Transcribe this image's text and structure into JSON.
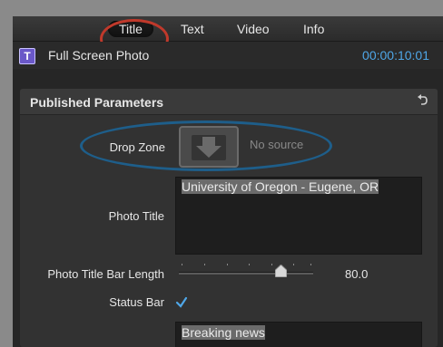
{
  "tabs": [
    {
      "label": "Title",
      "active": true
    },
    {
      "label": "Text",
      "active": false
    },
    {
      "label": "Video",
      "active": false
    },
    {
      "label": "Info",
      "active": false
    }
  ],
  "header": {
    "icon_letter": "T",
    "clip_name": "Full Screen Photo",
    "timecode": "00:00:10:01"
  },
  "panel": {
    "title": "Published Parameters",
    "drop_zone_label": "Drop Zone",
    "drop_zone_status": "No source",
    "photo_title_label": "Photo Title",
    "photo_title_value": "University of Oregon - Eugene, OR",
    "bar_length_label": "Photo Title Bar Length",
    "bar_length_value": "80.0",
    "bar_length_fraction": 0.8,
    "status_bar_label": "Status Bar",
    "status_bar_checked": true,
    "status_text_value": "Breaking news"
  },
  "colors": {
    "accent": "#4fa7e8",
    "title_ring": "#c0392b",
    "drop_ring": "#1e5e8a"
  }
}
